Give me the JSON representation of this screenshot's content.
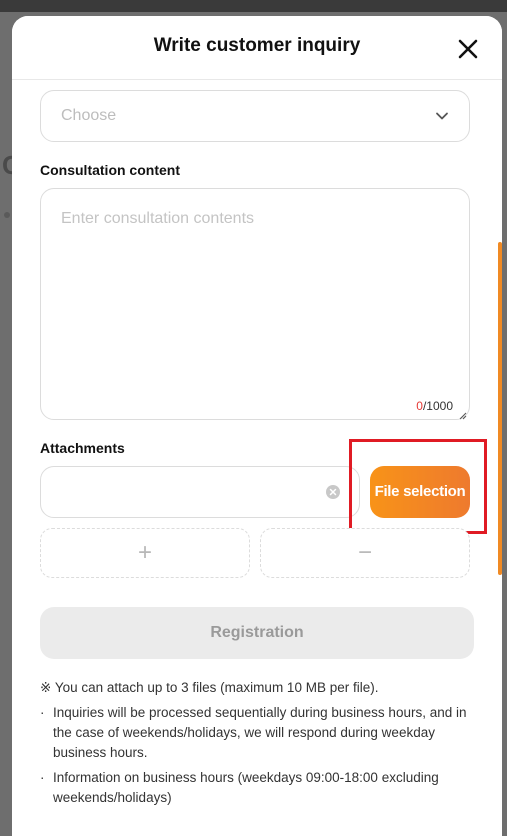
{
  "modal": {
    "title": "Write customer inquiry"
  },
  "category_select": {
    "placeholder": "Choose"
  },
  "consultation": {
    "label": "Consultation content",
    "placeholder": "Enter consultation contents",
    "count_current": "0",
    "count_max": "/1000"
  },
  "attachments": {
    "label": "Attachments",
    "file_selection_label": "File selection",
    "add_symbol": "+",
    "remove_symbol": "−"
  },
  "register_label": "Registration",
  "notes": {
    "attach_limit": "※ You can attach up to 3 files (maximum 10 MB per file).",
    "processing": "Inquiries will be processed sequentially during business hours, and in the case of weekends/holidays, we will respond during weekday business hours.",
    "hours": "Information on business hours (weekdays 09:00-18:00 excluding weekends/holidays)",
    "bullet": "·"
  },
  "colors": {
    "accent": "#f08a24",
    "highlight": "#e01b24",
    "counter_current": "#e53935"
  },
  "icons": {
    "close": "close-icon",
    "chevron": "chevron-down-icon",
    "clear": "clear-circle-icon"
  }
}
